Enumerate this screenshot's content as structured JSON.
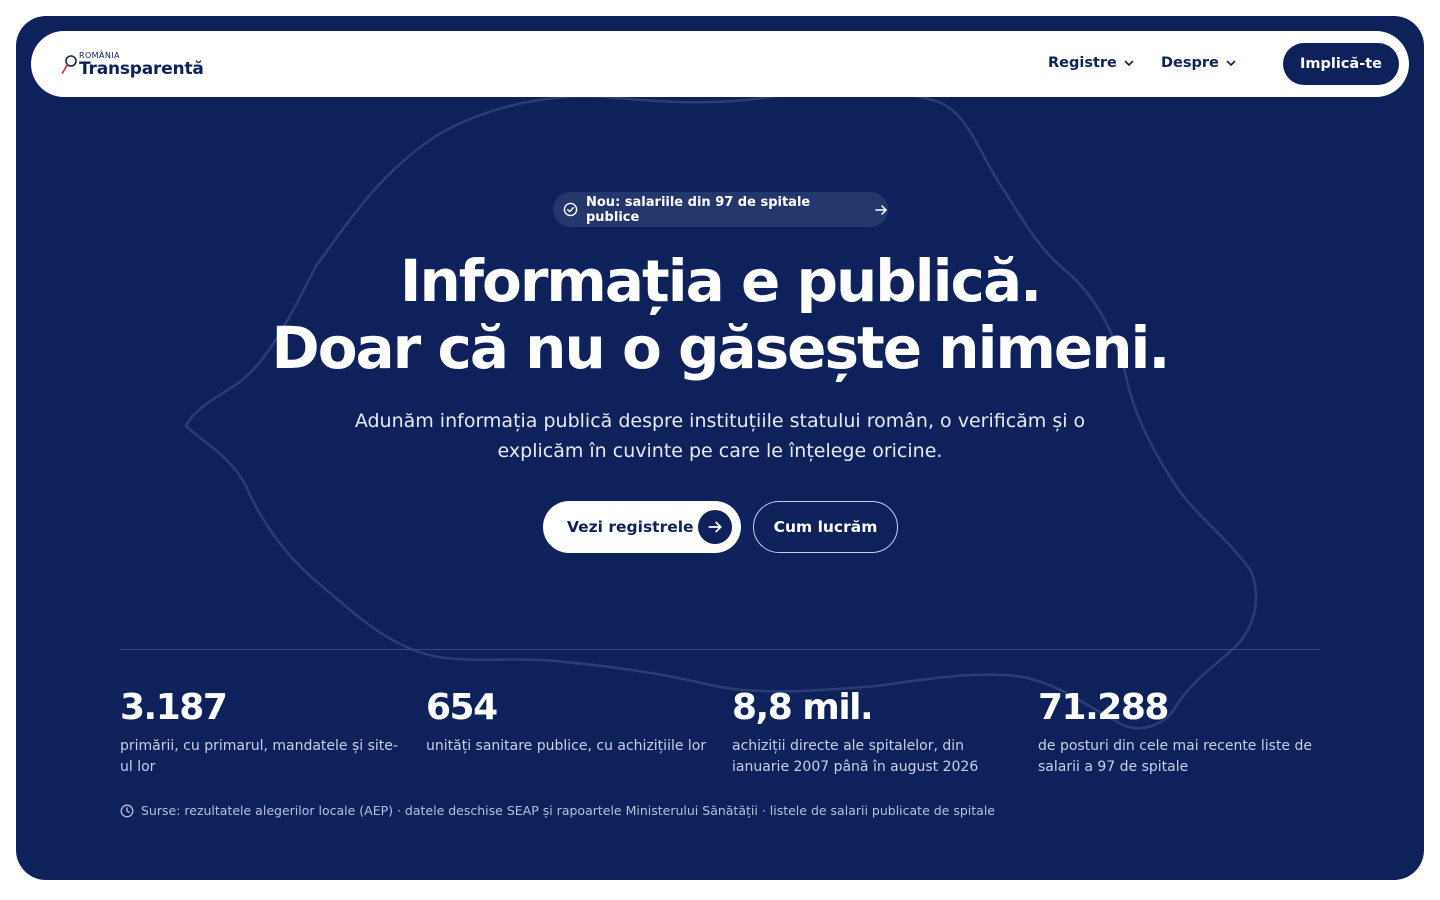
{
  "brand": {
    "small": "ROMÂNIA",
    "name": "Transparentă"
  },
  "nav": {
    "items": [
      {
        "label": "Registre"
      },
      {
        "label": "Despre"
      }
    ],
    "cta_label": "Implică-te"
  },
  "badge": {
    "text": "Nou: salariile din 97 de spitale publice"
  },
  "hero": {
    "headline_line1": "Informația e publică.",
    "headline_line2": "Doar că nu o găsește nimeni.",
    "subtitle": "Adunăm informația publică despre instituțiile statului român, o verificăm și o explicăm în cuvinte pe care le înțelege oricine.",
    "primary_button": "Vezi registrele",
    "secondary_button": "Cum lucrăm"
  },
  "stats": [
    {
      "value": "3.187",
      "label": "primării, cu primarul, mandatele și site-ul lor"
    },
    {
      "value": "654",
      "label": "unități sanitare publice, cu achizițiile lor"
    },
    {
      "value": "8,8 mil.",
      "label": "achiziții directe ale spitalelor, din ianuarie 2007 până în august 2026"
    },
    {
      "value": "71.288",
      "label": "de posturi din cele mai recente liste de salarii a 97 de spitale"
    }
  ],
  "sources": "Surse: rezultatele alegerilor locale (AEP) · datele deschise SEAP și rapoartele Ministerului Sănătății · listele de salarii publicate de spitale",
  "colors": {
    "primary": "#0e215b",
    "badge_bg": "#24366b",
    "white": "#ffffff"
  }
}
